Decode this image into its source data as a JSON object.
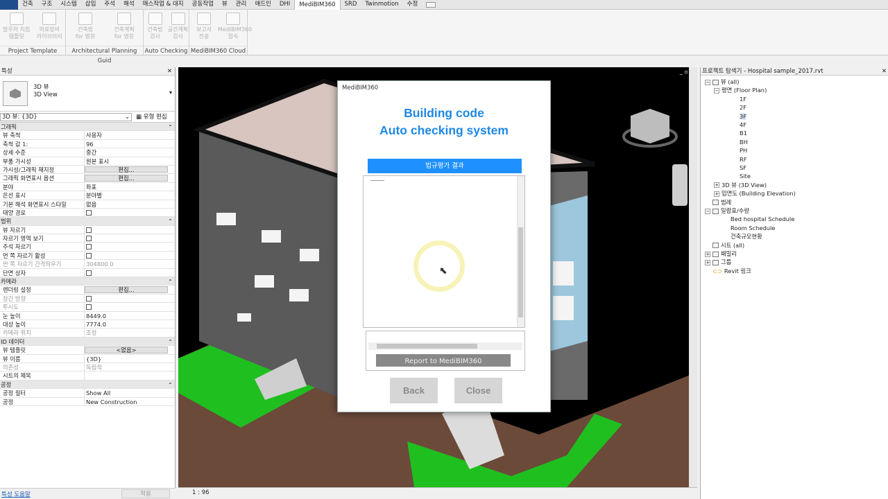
{
  "menubar": {
    "items": [
      "건축",
      "구조",
      "시스템",
      "삽입",
      "주석",
      "해석",
      "매스작업 & 대지",
      "공동작업",
      "뷰",
      "관리",
      "애드인",
      "DHI",
      "MediBIM360",
      "SRD",
      "Twinmotion",
      "수정"
    ],
    "active_index": 12
  },
  "ribbon": {
    "groups": [
      {
        "label": "Project Template",
        "buttons": [
          {
            "line1": "발주처 지침",
            "line2": "템플릿"
          },
          {
            "line1": "의료장비",
            "line2": "라이브러리"
          }
        ]
      },
      {
        "label": "Architectural Planning Guid",
        "buttons": [
          {
            "line1": "건축법",
            "line2": "for 병원"
          },
          {
            "line1": "건축계획",
            "line2": "for 병원"
          }
        ]
      },
      {
        "label": "Auto Checking",
        "buttons": [
          {
            "line1": "건축법",
            "line2": "검사"
          },
          {
            "line1": "공간계획",
            "line2": "검사"
          }
        ]
      },
      {
        "label": "MediBIM360 Cloud",
        "buttons": [
          {
            "line1": "보고서",
            "line2": "전송"
          },
          {
            "line1": "MediBIM360",
            "line2": "접속"
          }
        ]
      }
    ]
  },
  "properties": {
    "title": "특성",
    "type_line1": "3D 뷰",
    "type_line2": "3D View",
    "view_selector": "3D 뷰: {3D}",
    "edit_type": "유형 편집",
    "rows": [
      {
        "kind": "cat",
        "k": "그래픽"
      },
      {
        "k": "뷰 축척",
        "v": "사용자"
      },
      {
        "k": "축척 값    1:",
        "v": "96"
      },
      {
        "k": "상세 수준",
        "v": "중간"
      },
      {
        "k": "부품 가시성",
        "v": "원본 표시"
      },
      {
        "k": "가시성/그래픽 재지정",
        "v": "편집...",
        "btn": true
      },
      {
        "k": "그래픽 화면표시 옵션",
        "v": "편집...",
        "btn": true
      },
      {
        "k": "분야",
        "v": "좌표"
      },
      {
        "k": "은선 표시",
        "v": "분야별"
      },
      {
        "k": "기본 해석 화면표시 스타일",
        "v": "없음"
      },
      {
        "k": "태양 경로",
        "cb": true
      },
      {
        "kind": "cat",
        "k": "범위"
      },
      {
        "k": "뷰 자르기",
        "cb": true
      },
      {
        "k": "자르기 영역 보기",
        "cb": true
      },
      {
        "k": "주석 자르기",
        "cb": true
      },
      {
        "k": "먼 쪽 자르기 활성",
        "cb": true
      },
      {
        "k": "먼 쪽 자르기 간격띄우기",
        "v": "304800.0",
        "grey": true
      },
      {
        "k": "단면 상자",
        "cb": true
      },
      {
        "kind": "cat",
        "k": "카메라"
      },
      {
        "k": "렌더링 설정",
        "v": "편집...",
        "btn": true
      },
      {
        "k": "잠긴 방향",
        "cb": true,
        "grey": true
      },
      {
        "k": "투시도",
        "cb": true,
        "grey": true
      },
      {
        "k": "눈 높이",
        "v": "8449.0"
      },
      {
        "k": "대상 높이",
        "v": "7774.0"
      },
      {
        "k": "카메라 위치",
        "v": "조정",
        "grey": true
      },
      {
        "kind": "cat",
        "k": "ID 데이터"
      },
      {
        "k": "뷰 템플릿",
        "v": "<없음>",
        "btn": true
      },
      {
        "k": "뷰 이름",
        "v": "{3D}"
      },
      {
        "k": "의존성",
        "v": "독립적",
        "grey": true
      },
      {
        "k": "시트의 제목",
        "v": ""
      },
      {
        "kind": "cat",
        "k": "공정"
      },
      {
        "k": "공정 필터",
        "v": "Show All"
      },
      {
        "k": "공정",
        "v": "New Construction"
      }
    ],
    "help_link": "특성 도움말",
    "apply": "적용"
  },
  "viewport": {
    "scale": "1 : 96",
    "controls": "_ ▫ ×"
  },
  "browser": {
    "title": "프로젝트 탐색기 - Hospital sample_2017.rvt",
    "nodes": [
      {
        "label": "뷰 (all)",
        "depth": 0,
        "exp": "−",
        "ico": true
      },
      {
        "label": "평면 (Floor Plan)",
        "depth": 1,
        "exp": "−"
      },
      {
        "label": "1F",
        "depth": 3
      },
      {
        "label": "2F",
        "depth": 3
      },
      {
        "label": "3F",
        "depth": 3,
        "selected": true
      },
      {
        "label": "4F",
        "depth": 3
      },
      {
        "label": "B1",
        "depth": 3
      },
      {
        "label": "BH",
        "depth": 3
      },
      {
        "label": "PH",
        "depth": 3
      },
      {
        "label": "RF",
        "depth": 3
      },
      {
        "label": "SF",
        "depth": 3
      },
      {
        "label": "Site",
        "depth": 3
      },
      {
        "label": "3D 뷰 (3D View)",
        "depth": 1,
        "exp": "+"
      },
      {
        "label": "입면도 (Building Elevation)",
        "depth": 1,
        "exp": "+"
      },
      {
        "label": "범례",
        "depth": 0,
        "ico": true
      },
      {
        "label": "일람표/수량",
        "depth": 0,
        "exp": "−",
        "ico": true
      },
      {
        "label": "Bed hospital Schedule",
        "depth": 2
      },
      {
        "label": "Room Schedule",
        "depth": 2
      },
      {
        "label": "건축규모현황",
        "depth": 2
      },
      {
        "label": "시트 (all)",
        "depth": 0,
        "ico": true
      },
      {
        "label": "패밀리",
        "depth": 0,
        "exp": "+",
        "ico": true
      },
      {
        "label": "그룹",
        "depth": 0,
        "exp": "+",
        "ico": true
      },
      {
        "label": "Revit 링크",
        "depth": 0,
        "link": true
      }
    ]
  },
  "dialog": {
    "title": "MediBIM360",
    "headline1": "Building  code",
    "headline2": "Auto checking system",
    "result_bar": "법규평가 결과",
    "report_button": "Report to MediBIM360",
    "back_button": "Back",
    "close_button": "Close"
  },
  "colors": {
    "accent": "#1e88e5",
    "result_bar": "#1e90ff",
    "viewport_bg": "#000000",
    "ground_green": "#1fbf1f"
  }
}
